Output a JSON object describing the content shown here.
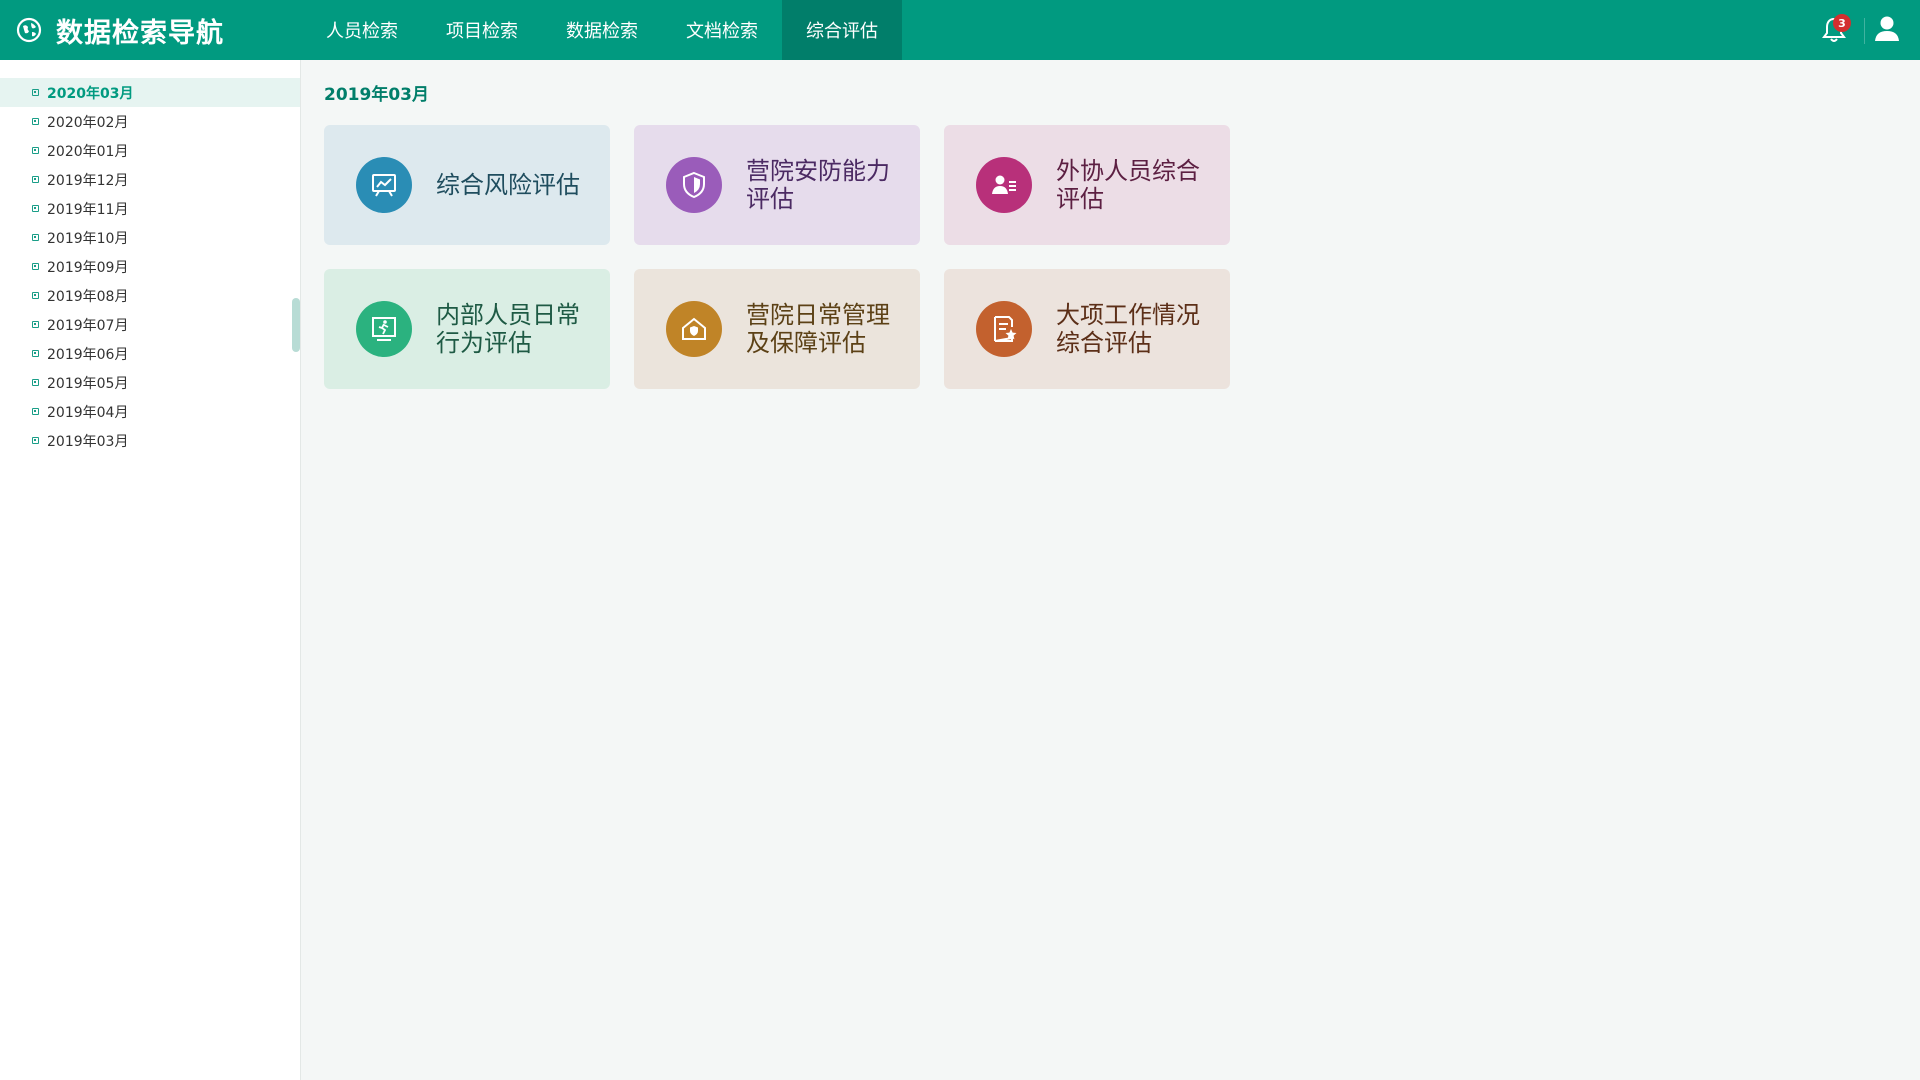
{
  "header": {
    "title": "数据检索导航",
    "nav": [
      {
        "label": "人员检索",
        "active": false
      },
      {
        "label": "项目检索",
        "active": false
      },
      {
        "label": "数据检索",
        "active": false
      },
      {
        "label": "文档检索",
        "active": false
      },
      {
        "label": "综合评估",
        "active": true
      }
    ],
    "notification_count": "3",
    "icons": {
      "brand": "globe-icon",
      "bell": "bell-icon",
      "user": "user-icon"
    }
  },
  "sidebar": {
    "items": [
      {
        "label": "2020年03月",
        "selected": true
      },
      {
        "label": "2020年02月",
        "selected": false
      },
      {
        "label": "2020年01月",
        "selected": false
      },
      {
        "label": "2019年12月",
        "selected": false
      },
      {
        "label": "2019年11月",
        "selected": false
      },
      {
        "label": "2019年10月",
        "selected": false
      },
      {
        "label": "2019年09月",
        "selected": false
      },
      {
        "label": "2019年08月",
        "selected": false
      },
      {
        "label": "2019年07月",
        "selected": false
      },
      {
        "label": "2019年06月",
        "selected": false
      },
      {
        "label": "2019年05月",
        "selected": false
      },
      {
        "label": "2019年04月",
        "selected": false
      },
      {
        "label": "2019年03月",
        "selected": false
      }
    ]
  },
  "main": {
    "section_title": "2019年03月",
    "cards": [
      {
        "line1": "综合风险评估",
        "line2": "",
        "icon": "chart-board-icon",
        "color": "#2a8db5",
        "text_color": "#1f4d5e"
      },
      {
        "line1": "营院安防能力",
        "line2": "评估",
        "icon": "shield-icon",
        "color": "#9a5cba",
        "text_color": "#4b2a63"
      },
      {
        "line1": "外协人员综合",
        "line2": "评估",
        "icon": "user-card-icon",
        "color": "#b8307a",
        "text_color": "#5c1f42"
      },
      {
        "line1": "内部人员日常",
        "line2": "行为评估",
        "icon": "person-running-board-icon",
        "color": "#2bb27f",
        "text_color": "#1e5a44"
      },
      {
        "line1": "营院日常管理",
        "line2": "及保障评估",
        "icon": "house-shield-icon",
        "color": "#c08427",
        "text_color": "#5c4116"
      },
      {
        "line1": "大项工作情况",
        "line2": "综合评估",
        "icon": "document-star-icon",
        "color": "#c3612e",
        "text_color": "#5c2f18"
      }
    ]
  }
}
